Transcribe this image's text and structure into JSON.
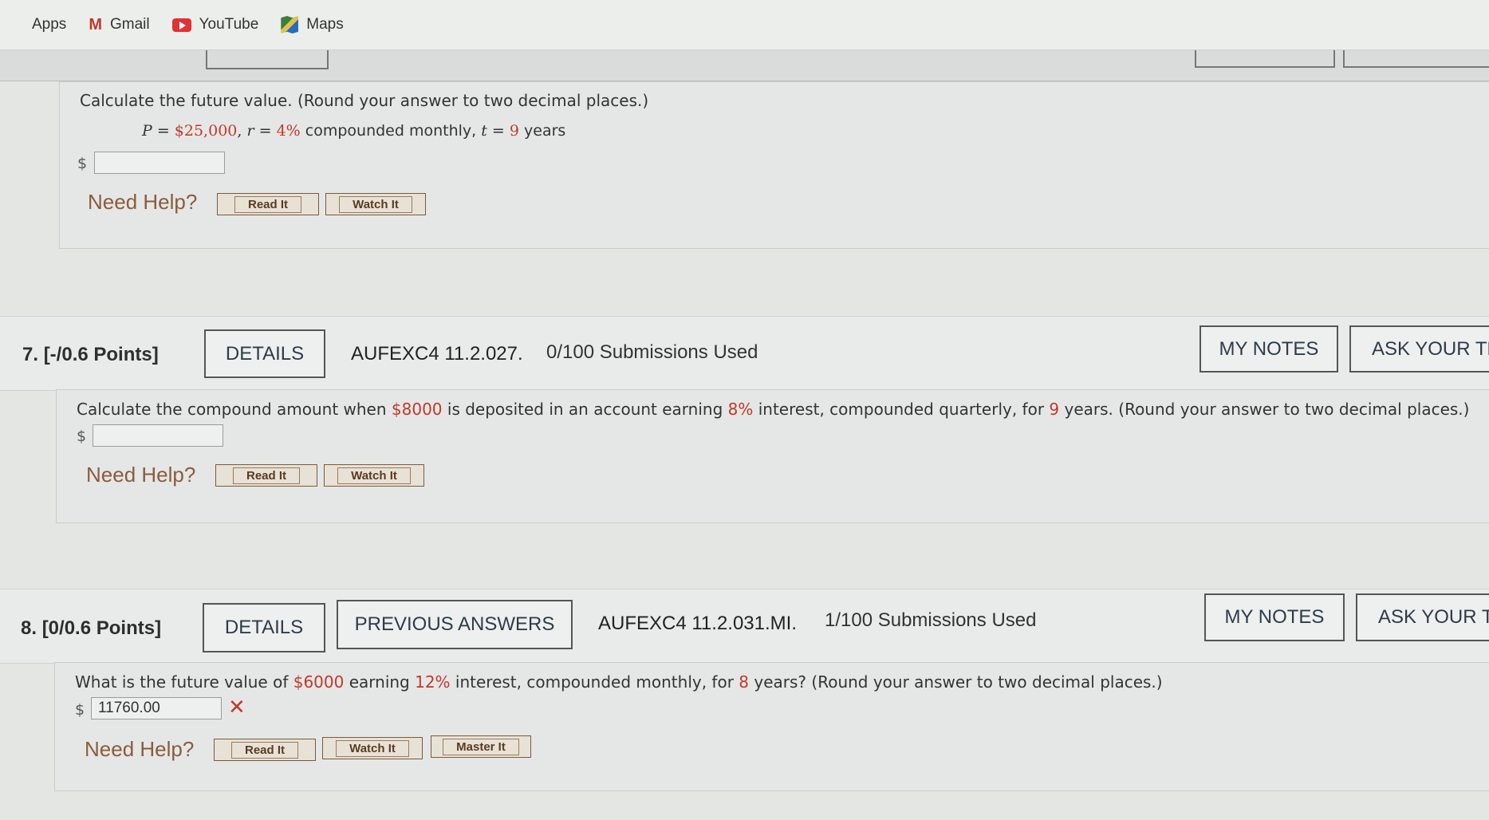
{
  "bookmarks": {
    "apps": "Apps",
    "gmail": "Gmail",
    "youtube": "YouTube",
    "maps": "Maps"
  },
  "colors": {
    "highlight": "#c0392b",
    "help_text": "#8a5c3c"
  },
  "question6": {
    "prompt": "Calculate the future value. (Round your answer to two decimal places.)",
    "formula": {
      "p_var": "P",
      "eq1": " = ",
      "p_val": "$25,000",
      "comma1": ", ",
      "r_var": "r",
      "eq2": " = ",
      "r_val": "4%",
      "mid": " compounded monthly, ",
      "t_var": "t",
      "eq3": " = ",
      "t_val": "9",
      "end": " years"
    },
    "currency": "$",
    "answer": "",
    "need_help": "Need Help?",
    "read_it": "Read It",
    "watch_it": "Watch It"
  },
  "question7": {
    "number": "7.",
    "points": "[-/0.6 Points]",
    "details": "DETAILS",
    "code": "AUFEXC4 11.2.027.",
    "submissions": "0/100 Submissions Used",
    "my_notes": "MY NOTES",
    "ask_teacher": "ASK YOUR TE",
    "prompt": {
      "p1": "Calculate the compound amount when ",
      "amount": "$8000",
      "p2": " is deposited in an account earning ",
      "rate": "8%",
      "p3": " interest, compounded quarterly, for ",
      "years": "9",
      "p4": " years. (Round your answer to two decimal places.)"
    },
    "currency": "$",
    "answer": "",
    "need_help": "Need Help?",
    "read_it": "Read It",
    "watch_it": "Watch It"
  },
  "question8": {
    "number": "8.",
    "points": "[0/0.6 Points]",
    "details": "DETAILS",
    "previous_answers": "PREVIOUS ANSWERS",
    "code": "AUFEXC4 11.2.031.MI.",
    "submissions": "1/100 Submissions Used",
    "my_notes": "MY NOTES",
    "ask_teacher": "ASK YOUR T",
    "prompt": {
      "p1": "What is the future value of ",
      "amount": "$6000",
      "p2": " earning ",
      "rate": "12%",
      "p3": " interest, compounded monthly, for ",
      "years": "8",
      "p4": " years? (Round your answer to two decimal places.)"
    },
    "currency": "$",
    "answer": "11760.00",
    "incorrect_mark": "✕",
    "need_help": "Need Help?",
    "read_it": "Read It",
    "watch_it": "Watch It",
    "master_it": "Master It"
  }
}
